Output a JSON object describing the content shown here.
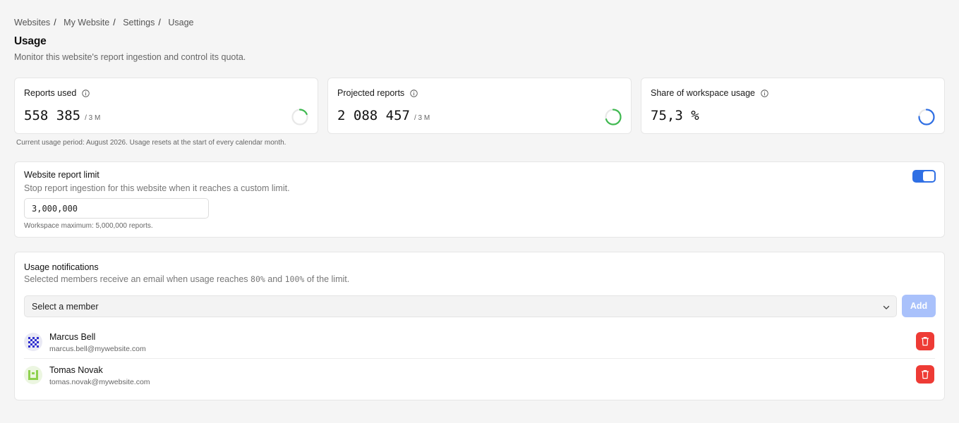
{
  "breadcrumb": [
    "Websites",
    "My Website",
    "Settings",
    "Usage"
  ],
  "page": {
    "title": "Usage",
    "subtitle": "Monitor this website's report ingestion and control its quota."
  },
  "stats": [
    {
      "label": "Reports used",
      "value": "558 385",
      "suffix": "/ 3 M",
      "ring_fraction": 0.186,
      "ring_color": "#3fb950",
      "icon": "info-icon"
    },
    {
      "label": "Projected reports",
      "value": "2 088 457",
      "suffix": "/ 3 M",
      "ring_fraction": 0.696,
      "ring_color": "#3fb950",
      "icon": "info-icon"
    },
    {
      "label": "Share of workspace usage",
      "value": "75,3 %",
      "suffix": "",
      "ring_fraction": 0.753,
      "ring_color": "#2f6fe4",
      "icon": "info-icon"
    }
  ],
  "period_note": "Current usage period: August 2026. Usage resets at the start of every calendar month.",
  "limit": {
    "title": "Website report limit",
    "description": "Stop report ingestion for this website when it reaches a custom limit.",
    "value": "3,000,000",
    "hint": "Workspace maximum: 5,000,000 reports.",
    "enabled": true
  },
  "notifications": {
    "title": "Usage notifications",
    "description_pre": "Selected members receive an email when usage reaches ",
    "threshold_1": "80%",
    "description_mid": " and ",
    "threshold_2": "100%",
    "description_post": " of the limit.",
    "select_placeholder": "Select a member",
    "add_label": "Add",
    "members": [
      {
        "name": "Marcus Bell",
        "email": "marcus.bell@mywebsite.com",
        "avatar_color": "#2f2fd0"
      },
      {
        "name": "Tomas Novak",
        "email": "tomas.novak@mywebsite.com",
        "avatar_color": "#8fd14f"
      }
    ]
  },
  "colors": {
    "accent": "#2f6fe4",
    "success": "#3fb950",
    "danger": "#ee3b35",
    "add_button_disabled": "#a9c1fb"
  }
}
